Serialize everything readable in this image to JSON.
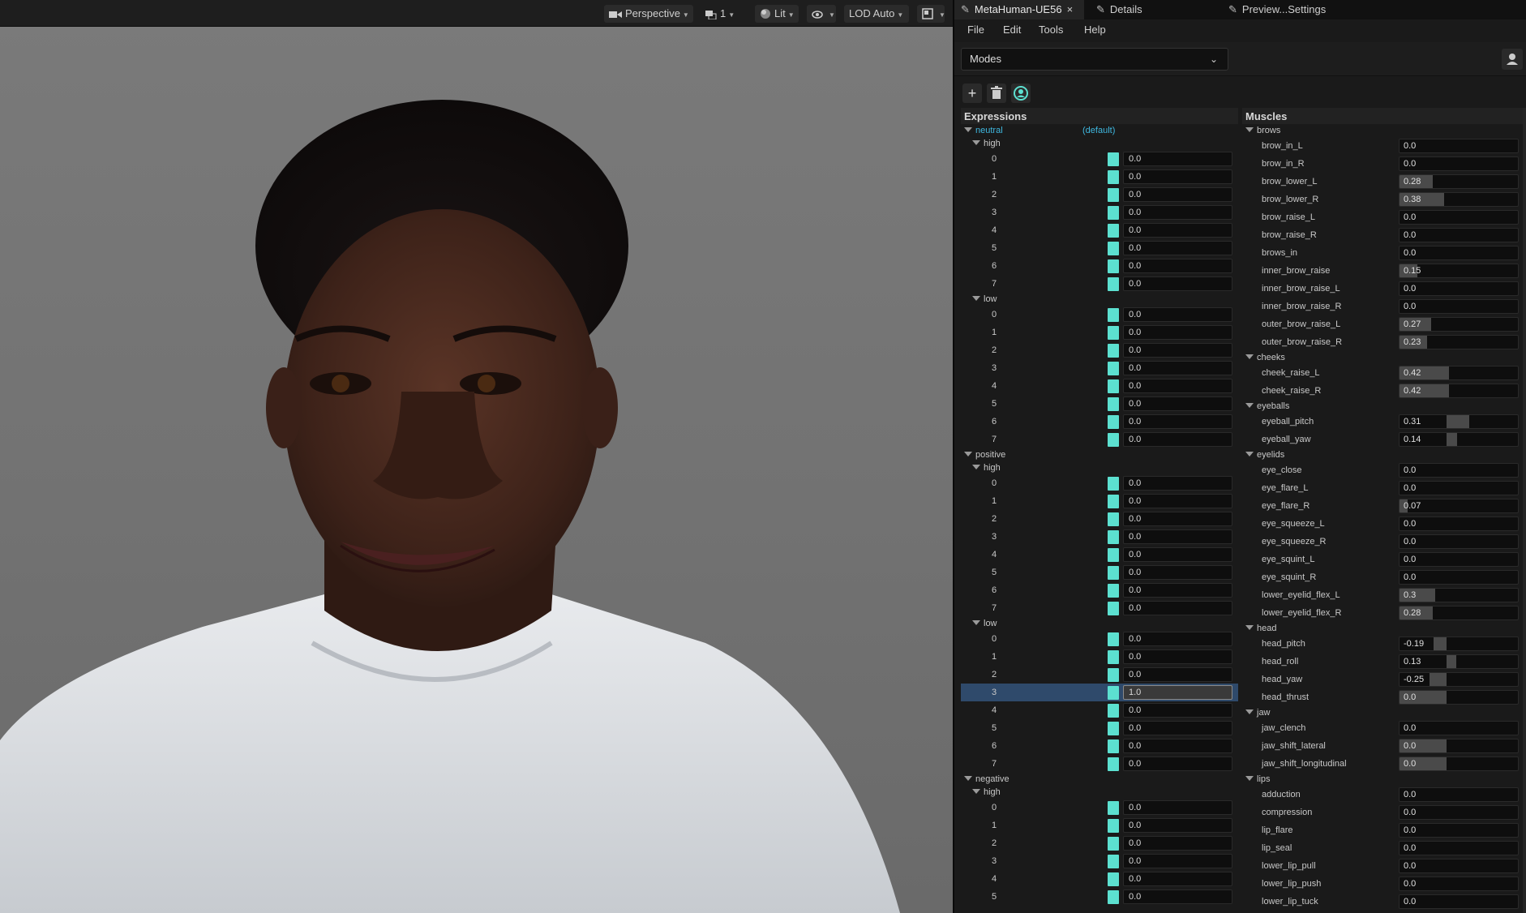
{
  "viewport": {
    "toolbar": {
      "perspective": "Perspective",
      "camera_speed": "1",
      "view_mode": "Lit",
      "lod": "LOD Auto"
    }
  },
  "tabs": [
    {
      "label": "MetaHuman-UE56",
      "close": "×"
    },
    {
      "label": "Details"
    },
    {
      "label": "Preview...Settings"
    }
  ],
  "menu": [
    "File",
    "Edit",
    "Tools",
    "Help"
  ],
  "modes": {
    "label": "Modes"
  },
  "expressions": {
    "title": "Expressions",
    "default_label": "(default)",
    "groups": [
      {
        "name": "neutral",
        "subs": [
          {
            "name": "high",
            "values": [
              "0.0",
              "0.0",
              "0.0",
              "0.0",
              "0.0",
              "0.0",
              "0.0",
              "0.0"
            ]
          },
          {
            "name": "low",
            "values": [
              "0.0",
              "0.0",
              "0.0",
              "0.0",
              "0.0",
              "0.0",
              "0.0",
              "0.0"
            ]
          }
        ]
      },
      {
        "name": "positive",
        "subs": [
          {
            "name": "high",
            "values": [
              "0.0",
              "0.0",
              "0.0",
              "0.0",
              "0.0",
              "0.0",
              "0.0",
              "0.0"
            ]
          },
          {
            "name": "low",
            "values": [
              "0.0",
              "0.0",
              "0.0",
              "1.0",
              "0.0",
              "0.0",
              "0.0",
              "0.0"
            ]
          }
        ]
      },
      {
        "name": "negative",
        "subs": [
          {
            "name": "high",
            "values": [
              "0.0",
              "0.0",
              "0.0",
              "0.0",
              "0.0",
              "0.0"
            ]
          }
        ]
      }
    ]
  },
  "muscles": {
    "title": "Muscles",
    "groups": [
      {
        "name": "brows",
        "items": [
          {
            "name": "brow_in_L",
            "value": "0.0",
            "fill": 0
          },
          {
            "name": "brow_in_R",
            "value": "0.0",
            "fill": 0
          },
          {
            "name": "brow_lower_L",
            "value": "0.28",
            "fill": 0.28
          },
          {
            "name": "brow_lower_R",
            "value": "0.38",
            "fill": 0.38
          },
          {
            "name": "brow_raise_L",
            "value": "0.0",
            "fill": 0
          },
          {
            "name": "brow_raise_R",
            "value": "0.0",
            "fill": 0
          },
          {
            "name": "brows_in",
            "value": "0.0",
            "fill": 0
          },
          {
            "name": "inner_brow_raise",
            "value": "0.15",
            "fill": 0.15
          },
          {
            "name": "inner_brow_raise_L",
            "value": "0.0",
            "fill": 0
          },
          {
            "name": "inner_brow_raise_R",
            "value": "0.0",
            "fill": 0
          },
          {
            "name": "outer_brow_raise_L",
            "value": "0.27",
            "fill": 0.27
          },
          {
            "name": "outer_brow_raise_R",
            "value": "0.23",
            "fill": 0.23
          }
        ]
      },
      {
        "name": "cheeks",
        "items": [
          {
            "name": "cheek_raise_L",
            "value": "0.42",
            "fill": 0.42
          },
          {
            "name": "cheek_raise_R",
            "value": "0.42",
            "fill": 0.42
          }
        ]
      },
      {
        "name": "eyeballs",
        "items": [
          {
            "name": "eyeball_pitch",
            "value": "0.31",
            "fill": 0.31,
            "bipolar": true
          },
          {
            "name": "eyeball_yaw",
            "value": "0.14",
            "fill": 0.14,
            "bipolar": true
          }
        ]
      },
      {
        "name": "eyelids",
        "items": [
          {
            "name": "eye_close",
            "value": "0.0",
            "fill": 0
          },
          {
            "name": "eye_flare_L",
            "value": "0.0",
            "fill": 0
          },
          {
            "name": "eye_flare_R",
            "value": "0.07",
            "fill": 0.07
          },
          {
            "name": "eye_squeeze_L",
            "value": "0.0",
            "fill": 0
          },
          {
            "name": "eye_squeeze_R",
            "value": "0.0",
            "fill": 0
          },
          {
            "name": "eye_squint_L",
            "value": "0.0",
            "fill": 0
          },
          {
            "name": "eye_squint_R",
            "value": "0.0",
            "fill": 0
          },
          {
            "name": "lower_eyelid_flex_L",
            "value": "0.3",
            "fill": 0.3
          },
          {
            "name": "lower_eyelid_flex_R",
            "value": "0.28",
            "fill": 0.28
          }
        ]
      },
      {
        "name": "head",
        "items": [
          {
            "name": "head_pitch",
            "value": "-0.19",
            "fill": -0.19,
            "bipolar": true
          },
          {
            "name": "head_roll",
            "value": "0.13",
            "fill": 0.13,
            "bipolar": true
          },
          {
            "name": "head_yaw",
            "value": "-0.25",
            "fill": -0.25,
            "bipolar": true
          },
          {
            "name": "head_thrust",
            "value": "0.0",
            "fill": 0,
            "bipolar": true
          }
        ]
      },
      {
        "name": "jaw",
        "items": [
          {
            "name": "jaw_clench",
            "value": "0.0",
            "fill": 0
          },
          {
            "name": "jaw_shift_lateral",
            "value": "0.0",
            "fill": 0,
            "bipolar": true
          },
          {
            "name": "jaw_shift_longitudinal",
            "value": "0.0",
            "fill": 0,
            "bipolar": true
          }
        ]
      },
      {
        "name": "lips",
        "items": [
          {
            "name": "adduction",
            "value": "0.0",
            "fill": 0
          },
          {
            "name": "compression",
            "value": "0.0",
            "fill": 0
          },
          {
            "name": "lip_flare",
            "value": "0.0",
            "fill": 0
          },
          {
            "name": "lip_seal",
            "value": "0.0",
            "fill": 0
          },
          {
            "name": "lower_lip_pull",
            "value": "0.0",
            "fill": 0
          },
          {
            "name": "lower_lip_push",
            "value": "0.0",
            "fill": 0
          },
          {
            "name": "lower_lip_tuck",
            "value": "0.0",
            "fill": 0
          }
        ]
      }
    ]
  },
  "colors": {
    "swatch": "#5ce0d0",
    "selection": "#2f4a6b",
    "default_label": "#3fb8e0"
  },
  "selected": {
    "group": "positive",
    "sub": "low",
    "index": 3
  }
}
